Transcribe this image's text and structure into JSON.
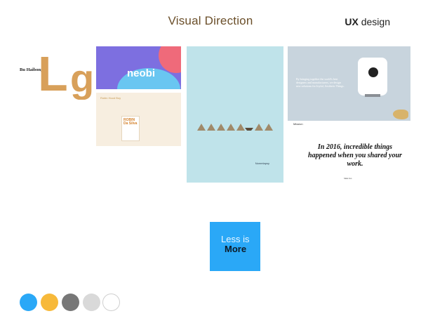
{
  "header": {
    "title": "Visual Direction",
    "tag_bold": "UX",
    "tag_light": "design"
  },
  "cards": [
    {
      "type": "typography",
      "name_text": "Bu Haibong",
      "letters": "Lg",
      "accent": "#d8a05a"
    },
    {
      "type": "brand",
      "logo": "neobi",
      "colors": [
        "#7d6fe0",
        "#ef6a7a",
        "#69c6f1"
      ]
    },
    {
      "type": "book",
      "header": "Robin Hood Boy",
      "book_title": "ROBIN Da Silva",
      "accent": "#d4822d"
    },
    {
      "type": "illustration",
      "caption": "Nonrelapsy",
      "background": "#bfe3ea"
    },
    {
      "type": "product",
      "blurb": "By bringing together the world's best designers and manufacturers, we design new solutions for Joyful, Aesthetic Things.",
      "background": "#c8d4dd"
    },
    {
      "type": "quote",
      "nav": "Mission",
      "text": "In 2016, incredible things happened when you shared your work.",
      "foot": "SEE ALL"
    }
  ],
  "cta": {
    "line1": "Less is",
    "line2": "More",
    "color": "#2aa8f7"
  },
  "palette": [
    {
      "name": "blue",
      "color": "#2aa8f7"
    },
    {
      "name": "yellow",
      "color": "#f7b93a"
    },
    {
      "name": "dark-gray",
      "color": "#777777"
    },
    {
      "name": "light-gray",
      "color": "#d9d9d9"
    },
    {
      "name": "white",
      "color": "#ffffff"
    }
  ]
}
